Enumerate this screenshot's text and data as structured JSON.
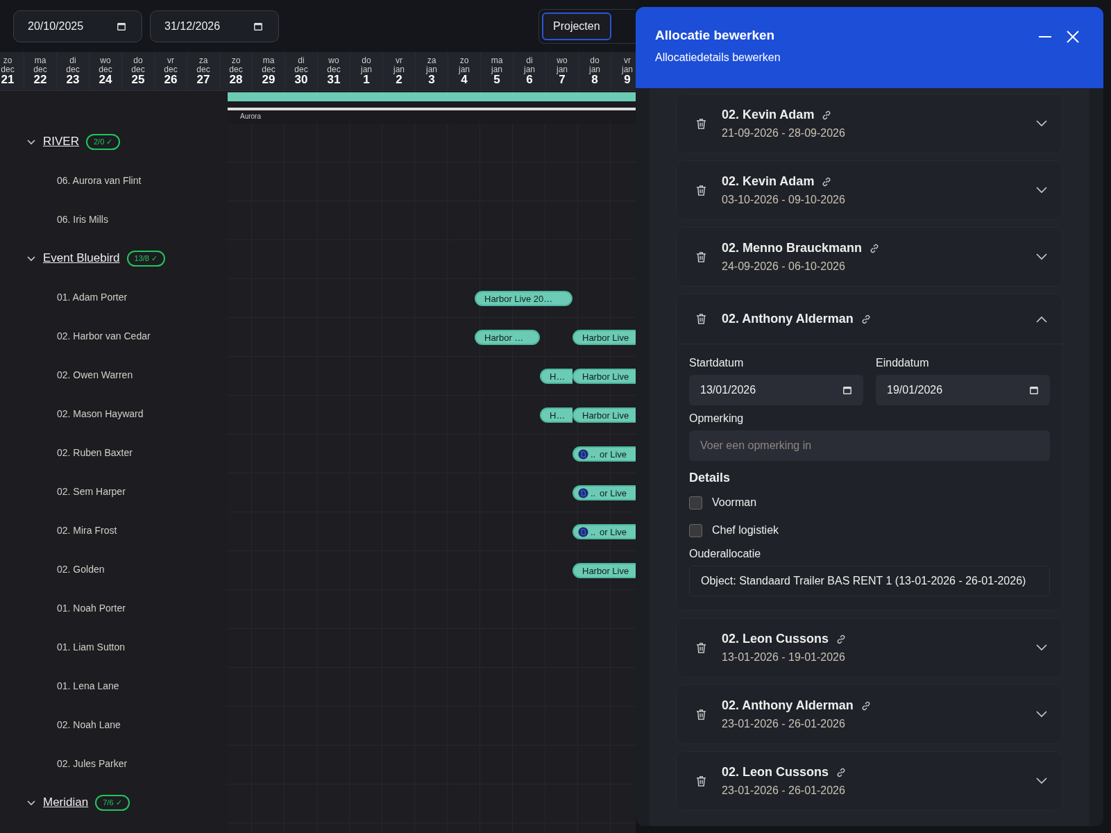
{
  "date_filters": [
    "20/10/2025",
    "31/12/2026"
  ],
  "view_toggle": [
    {
      "label": "Projecten",
      "selected": true
    }
  ],
  "days": [
    {
      "weekday": "zo",
      "month": "dec",
      "day": "21"
    },
    {
      "weekday": "ma",
      "month": "dec",
      "day": "22"
    },
    {
      "weekday": "di",
      "month": "dec",
      "day": "23"
    },
    {
      "weekday": "wo",
      "month": "dec",
      "day": "24"
    },
    {
      "weekday": "do",
      "month": "dec",
      "day": "25"
    },
    {
      "weekday": "vr",
      "month": "dec",
      "day": "26"
    },
    {
      "weekday": "za",
      "month": "dec",
      "day": "27"
    },
    {
      "weekday": "zo",
      "month": "dec",
      "day": "28"
    },
    {
      "weekday": "ma",
      "month": "dec",
      "day": "29"
    },
    {
      "weekday": "di",
      "month": "dec",
      "day": "30"
    },
    {
      "weekday": "wo",
      "month": "dec",
      "day": "31"
    },
    {
      "weekday": "do",
      "month": "jan",
      "day": "1"
    },
    {
      "weekday": "vr",
      "month": "jan",
      "day": "2"
    },
    {
      "weekday": "za",
      "month": "jan",
      "day": "3"
    },
    {
      "weekday": "zo",
      "month": "jan",
      "day": "4"
    },
    {
      "weekday": "ma",
      "month": "jan",
      "day": "5"
    },
    {
      "weekday": "di",
      "month": "jan",
      "day": "6"
    },
    {
      "weekday": "wo",
      "month": "jan",
      "day": "7"
    },
    {
      "weekday": "do",
      "month": "jan",
      "day": "8"
    },
    {
      "weekday": "vr",
      "month": "jan",
      "day": "9"
    }
  ],
  "project_bar": {
    "label": "Aurora"
  },
  "groups": [
    {
      "name": "RIVER",
      "badge": "2/0 ✓",
      "expanded": true,
      "children": [
        {
          "name": "06. Aurora van Flint"
        },
        {
          "name": "06. Iris Mills"
        }
      ]
    },
    {
      "name": "Event Bluebird",
      "badge": "13/8 ✓",
      "expanded": true,
      "children": [
        {
          "name": "01. Adam Porter",
          "bars": [
            {
              "label": "Harbor Live 20…",
              "kind": "plain"
            }
          ]
        },
        {
          "name": "02. Harbor van Cedar",
          "bars": [
            {
              "label": "Harbor …",
              "kind": "plain"
            },
            {
              "label": "Harbor Live",
              "kind": "plain"
            }
          ]
        },
        {
          "name": "02. Owen Warren",
          "bars": [
            {
              "label": "H…",
              "kind": "plain"
            },
            {
              "label": "Harbor Live",
              "kind": "plain"
            }
          ]
        },
        {
          "name": "02. Mason Hayward",
          "bars": [
            {
              "label": "H…",
              "kind": "plain"
            },
            {
              "label": "Harbor Live",
              "kind": "plain"
            }
          ]
        },
        {
          "name": "02. Ruben Baxter",
          "bars": [
            {
              "label": "..",
              "kind": "file"
            },
            {
              "label": "or Live",
              "kind": "plain"
            }
          ]
        },
        {
          "name": "02. Sem Harper",
          "bars": [
            {
              "label": "..",
              "kind": "file"
            },
            {
              "label": "or Live",
              "kind": "plain"
            }
          ]
        },
        {
          "name": "02. Mira Frost",
          "bars": [
            {
              "label": "..",
              "kind": "file"
            },
            {
              "label": "or Live",
              "kind": "plain"
            }
          ]
        },
        {
          "name": "02. Golden",
          "bars": [
            {
              "label": "Harbor Live",
              "kind": "plain"
            }
          ]
        },
        {
          "name": "01. Noah Porter"
        },
        {
          "name": "01. Liam Sutton"
        },
        {
          "name": "01. Lena Lane"
        },
        {
          "name": "02. Noah Lane"
        },
        {
          "name": "02. Jules Parker"
        }
      ]
    },
    {
      "name": "Meridian",
      "badge": "7/6 ✓",
      "expanded": true
    }
  ],
  "panel": {
    "title": "Allocatie bewerken",
    "subtitle": "Allocatiedetails bewerken",
    "allocations": [
      {
        "name": "02. Kevin Adam",
        "dates": "21-09-2026 - 28-09-2026",
        "expanded": false
      },
      {
        "name": "02. Kevin Adam",
        "dates": "03-10-2026 - 09-10-2026",
        "expanded": false
      },
      {
        "name": "02. Menno Brauckmann",
        "dates": "24-09-2026 - 06-10-2026",
        "expanded": false
      },
      {
        "name": "02. Anthony Alderman",
        "expanded": true,
        "form": {
          "start_label": "Startdatum",
          "start_value": "13/01/2026",
          "end_label": "Einddatum",
          "end_value": "19/01/2026",
          "remark_label": "Opmerking",
          "remark_placeholder": "Voer een opmerking in",
          "details_heading": "Details",
          "checkboxes": [
            {
              "label": "Voorman",
              "checked": false
            },
            {
              "label": "Chef logistiek",
              "checked": false
            }
          ],
          "parent_label": "Ouderallocatie",
          "parent_value": "Object: Standaard Trailer BAS RENT 1 (13-01-2026 - 26-01-2026)"
        }
      },
      {
        "name": "02. Leon Cussons",
        "dates": "13-01-2026 - 19-01-2026",
        "expanded": false
      },
      {
        "name": "02. Anthony Alderman",
        "dates": "23-01-2026 - 26-01-2026",
        "expanded": false
      },
      {
        "name": "02. Leon Cussons",
        "dates": "23-01-2026 - 26-01-2026",
        "expanded": false
      }
    ]
  }
}
